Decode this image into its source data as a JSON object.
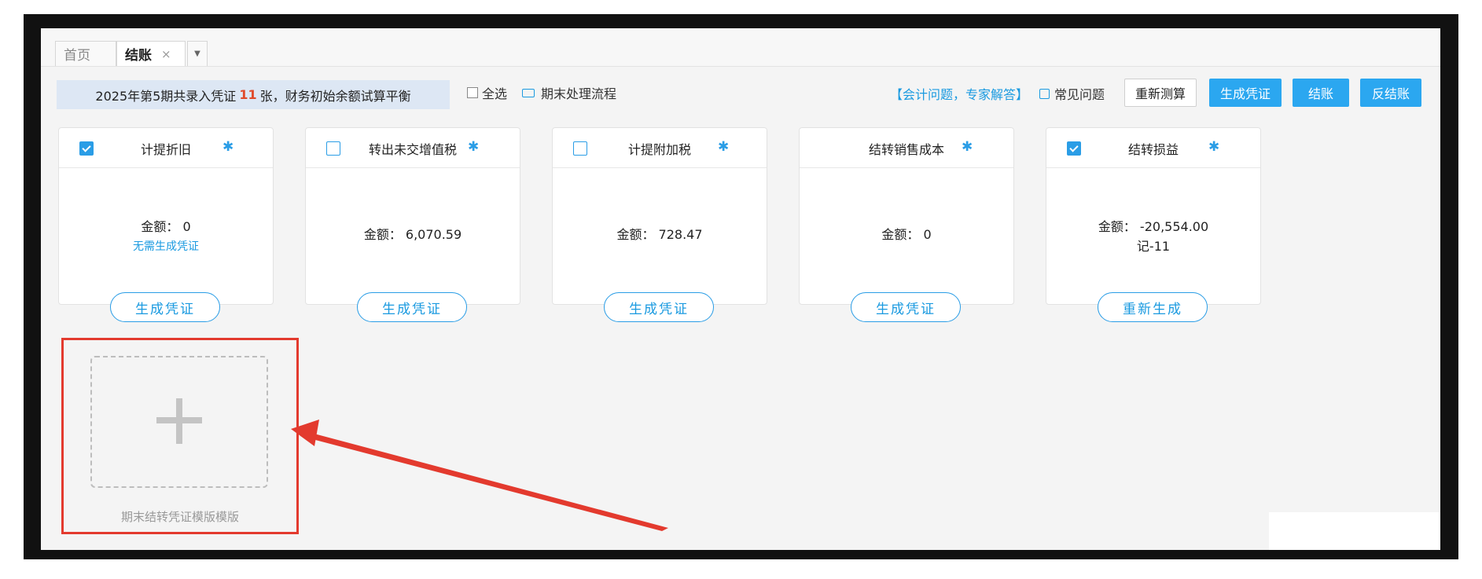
{
  "tabs": {
    "home": "首页",
    "active": "结账",
    "close_icon": "×",
    "dropdown_icon": "▼"
  },
  "toolbar": {
    "summary_prefix": "2025年第5期共录入凭证",
    "summary_count": "11",
    "summary_suffix": "张，财务初始余额试算平衡",
    "select_all": "全选",
    "flow": "期末处理流程",
    "experts": "【会计问题，专家解答】",
    "faq": "常见问题",
    "recalc": "重新测算",
    "gen_voucher": "生成凭证",
    "close": "结账",
    "unclose": "反结账"
  },
  "cards": [
    {
      "title": "计提折旧",
      "checked": true,
      "amount": "金额：  0",
      "sub": "无需生成凭证",
      "button": "生成凭证"
    },
    {
      "title": "转出未交增值税",
      "checked": false,
      "amount": "金额：  6,070.59",
      "sub": "",
      "button": "生成凭证"
    },
    {
      "title": "计提附加税",
      "checked": false,
      "amount": "金额：  728.47",
      "sub": "",
      "button": "生成凭证"
    },
    {
      "title": "结转销售成本",
      "checked": null,
      "amount": "金额：  0",
      "sub": "",
      "button": "生成凭证"
    },
    {
      "title": "结转损益",
      "checked": true,
      "amount": "金额：  -20,554.00",
      "sub": "记-11",
      "button": "重新生成"
    }
  ],
  "add_template": {
    "label": "期末结转凭证模版模版"
  },
  "icons": {
    "gear": "gear-icon",
    "flow": "flow-icon",
    "faq": "question-icon",
    "plus": "plus-icon"
  },
  "colors": {
    "accent": "#2ba7f0",
    "annotation": "#e33a2e",
    "count_highlight": "#e04a2a"
  }
}
